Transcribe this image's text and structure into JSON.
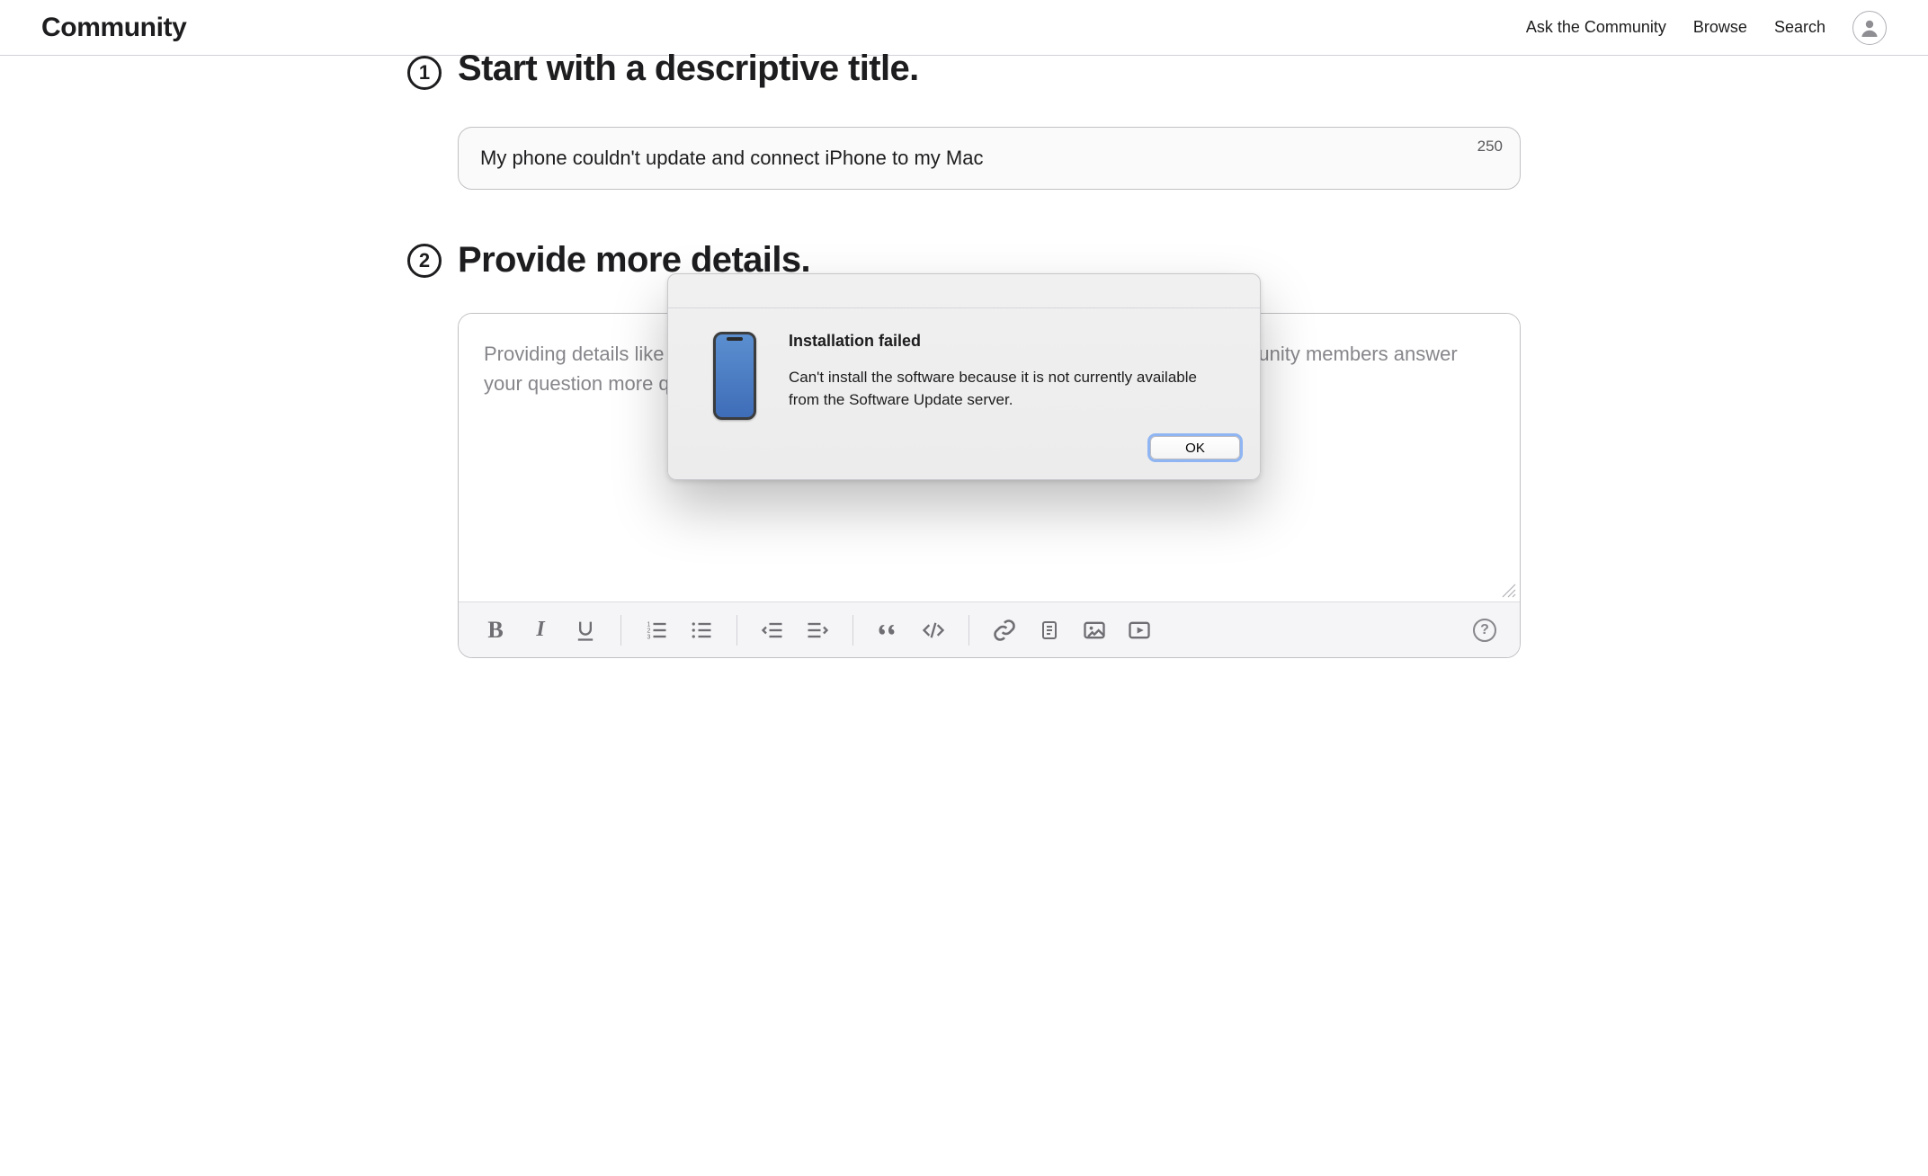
{
  "header": {
    "brand": "Community",
    "links": {
      "ask": "Ask the Community",
      "browse": "Browse",
      "search": "Search"
    }
  },
  "step1": {
    "number": "1",
    "heading": "Start with a descriptive title.",
    "title_value": "My phone couldn't update and connect iPhone to my Mac",
    "char_remaining": "250"
  },
  "step2": {
    "number": "2",
    "heading": "Provide more details.",
    "placeholder": "Providing details like what you've tried and what the exact symptoms are will help Community members answer your question more quickly and accurately."
  },
  "toolbar": {
    "help_label": "?"
  },
  "dialog": {
    "title": "Installation failed",
    "message": "Can't install the software because it is not currently available from the Software Update server.",
    "ok": "OK"
  }
}
